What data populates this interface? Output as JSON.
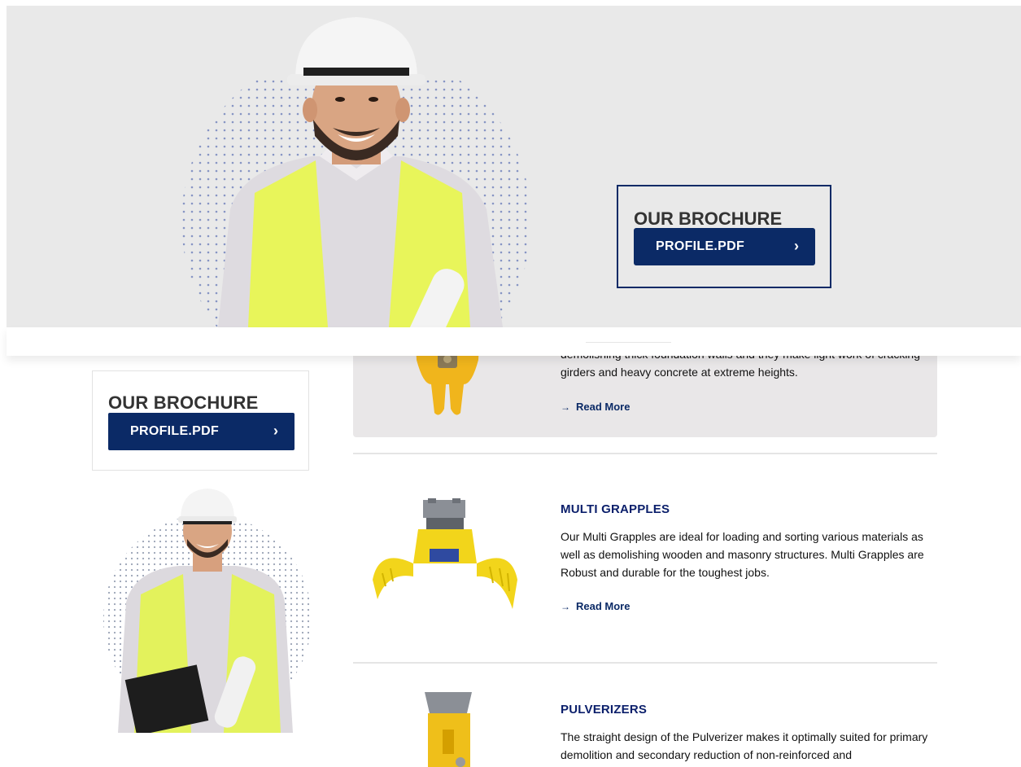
{
  "hero": {
    "brochure_title": "OUR BROCHURE",
    "brochure_button": "PROFILE.PDF",
    "chevron": "›"
  },
  "sidebar": {
    "brochure_title": "OUR BROCHURE",
    "brochure_button": "PROFILE.PDF",
    "chevron": "›"
  },
  "products": [
    {
      "title": "",
      "desc_partial_hidden": "demolishing thick foundation walls and they make light work of cracking",
      "desc_visible": "girders and heavy concrete at extreme heights.",
      "read_more": "Read More",
      "image": "yellow-crusher-attachment",
      "active": true
    },
    {
      "title": "MULTI GRAPPLES",
      "desc": "Our Multi Grapples are ideal for loading and sorting various materials as well as demolishing wooden and masonry structures. Multi Grapples are Robust and durable for the toughest jobs.",
      "read_more": "Read More",
      "image": "yellow-multi-grapple"
    },
    {
      "title": "PULVERIZERS",
      "desc": "The straight design of the Pulverizer makes it optimally suited for primary demolition and secondary reduction of non-reinforced and",
      "image": "yellow-pulverizer"
    }
  ],
  "read_more_arrow": "→",
  "colors": {
    "navy": "#0b2a66",
    "title_blue": "#0b1f6b",
    "hero_bg": "#e9e9e9",
    "active_row_bg": "#e9e7e8",
    "vest_yellow": "#e8f55a"
  }
}
